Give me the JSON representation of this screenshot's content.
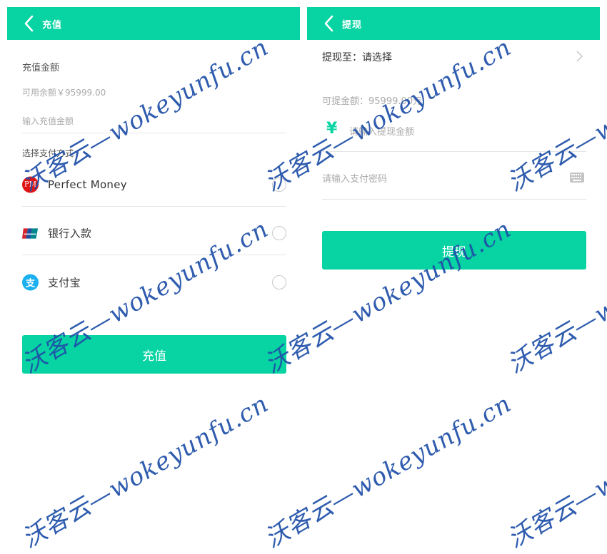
{
  "recharge": {
    "header_title": "充值",
    "amount_label": "充值金额",
    "available_balance": "可用余额￥95999.00",
    "amount_placeholder": "输入充值金额",
    "payment_method_label": "选择支付方式",
    "methods": [
      {
        "label": "Perfect Money",
        "icon": "perfect-money-icon",
        "icon_text": "PM"
      },
      {
        "label": "银行入款",
        "icon": "unionpay-icon"
      },
      {
        "label": "支付宝",
        "icon": "alipay-icon",
        "icon_text": "支"
      }
    ],
    "submit_label": "充值"
  },
  "withdraw": {
    "header_title": "提现",
    "destination_label": "提现至：请选择",
    "withdrawable": "可提金额：95999.00元",
    "currency_symbol": "¥",
    "amount_placeholder": "请输入提现金额",
    "password_placeholder": "请输入支付密码",
    "submit_label": "提现"
  },
  "watermark_text": "沃客云—wokeyunfu.cn",
  "colors": {
    "accent": "#07d3a3",
    "watermark": "#1e4fa8",
    "pm_red": "#e01515",
    "alipay_blue": "#1bb0ef"
  }
}
